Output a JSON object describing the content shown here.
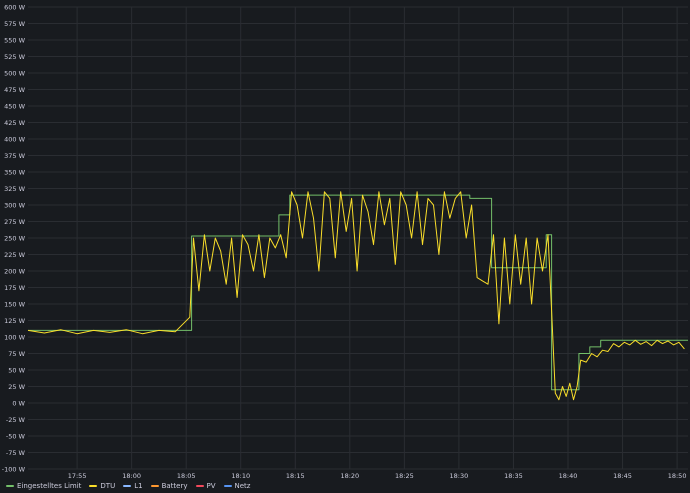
{
  "chart_data": {
    "type": "line",
    "title": "",
    "xlabel": "",
    "ylabel": "",
    "y_unit": "W",
    "ylim": [
      -100,
      600
    ],
    "y_ticks": [
      -100,
      -75,
      -50,
      -25,
      0,
      25,
      50,
      75,
      100,
      125,
      150,
      175,
      200,
      225,
      250,
      275,
      300,
      325,
      350,
      375,
      400,
      425,
      450,
      475,
      500,
      525,
      550,
      575,
      600
    ],
    "y_tick_labels": [
      "-100 W",
      "-75 W",
      "-50 W",
      "-25 W",
      "0 W",
      "25 W",
      "50 W",
      "75 W",
      "100 W",
      "125 W",
      "150 W",
      "175 W",
      "200 W",
      "225 W",
      "250 W",
      "275 W",
      "300 W",
      "325 W",
      "350 W",
      "375 W",
      "400 W",
      "425 W",
      "450 W",
      "475 W",
      "500 W",
      "525 W",
      "550 W",
      "575 W",
      "600 W"
    ],
    "xlim": [
      "17:50:30",
      "18:51:00"
    ],
    "x_ticks": [
      "17:55",
      "18:00",
      "18:05",
      "18:10",
      "18:15",
      "18:20",
      "18:25",
      "18:30",
      "18:35",
      "18:40",
      "18:45",
      "18:50"
    ],
    "grid": true,
    "legend_position": "bottom-left",
    "series": [
      {
        "name": "Eingestelltes Limit",
        "color": "#73bf69",
        "step": true,
        "x": [
          "17:50:30",
          "18:05:30",
          "18:13:30",
          "18:14:30",
          "18:31:00",
          "18:33:00",
          "18:38:00",
          "18:38:30",
          "18:41:00",
          "18:42:00",
          "18:43:00",
          "18:51:00"
        ],
        "y": [
          110,
          253,
          285,
          315,
          310,
          205,
          255,
          20,
          75,
          85,
          95,
          95
        ]
      },
      {
        "name": "DTU",
        "color": "#fade2a",
        "x": [
          "17:50:30",
          "17:52:00",
          "17:53:30",
          "17:55:00",
          "17:56:30",
          "17:58:00",
          "17:59:30",
          "18:01:00",
          "18:02:30",
          "18:04:00",
          "18:05:20",
          "18:05:40",
          "18:06:10",
          "18:06:40",
          "18:07:10",
          "18:07:40",
          "18:08:10",
          "18:08:40",
          "18:09:10",
          "18:09:40",
          "18:10:10",
          "18:10:40",
          "18:11:10",
          "18:11:40",
          "18:12:10",
          "18:12:40",
          "18:13:10",
          "18:13:40",
          "18:14:10",
          "18:14:40",
          "18:15:10",
          "18:15:40",
          "18:16:10",
          "18:16:40",
          "18:17:10",
          "18:17:40",
          "18:18:10",
          "18:18:40",
          "18:19:10",
          "18:19:40",
          "18:20:10",
          "18:20:40",
          "18:21:10",
          "18:21:40",
          "18:22:10",
          "18:22:40",
          "18:23:10",
          "18:23:40",
          "18:24:10",
          "18:24:40",
          "18:25:10",
          "18:25:40",
          "18:26:10",
          "18:26:40",
          "18:27:10",
          "18:27:40",
          "18:28:10",
          "18:28:40",
          "18:29:10",
          "18:29:40",
          "18:30:10",
          "18:30:40",
          "18:31:10",
          "18:31:40",
          "18:32:10",
          "18:32:40",
          "18:33:10",
          "18:33:40",
          "18:34:10",
          "18:34:40",
          "18:35:10",
          "18:35:40",
          "18:36:10",
          "18:36:40",
          "18:37:10",
          "18:37:40",
          "18:38:10",
          "18:38:30",
          "18:38:50",
          "18:39:10",
          "18:39:30",
          "18:39:50",
          "18:40:10",
          "18:40:30",
          "18:40:50",
          "18:41:10",
          "18:41:40",
          "18:42:10",
          "18:42:40",
          "18:43:10",
          "18:43:40",
          "18:44:10",
          "18:44:40",
          "18:45:10",
          "18:45:40",
          "18:46:10",
          "18:46:40",
          "18:47:10",
          "18:47:40",
          "18:48:10",
          "18:48:40",
          "18:49:10",
          "18:49:40",
          "18:50:10",
          "18:50:40"
        ],
        "y": [
          110,
          106,
          111,
          105,
          110,
          107,
          111,
          105,
          110,
          108,
          130,
          250,
          170,
          255,
          200,
          250,
          230,
          180,
          250,
          160,
          255,
          240,
          200,
          255,
          190,
          250,
          235,
          255,
          220,
          320,
          300,
          250,
          320,
          280,
          200,
          320,
          310,
          220,
          320,
          260,
          310,
          200,
          315,
          290,
          240,
          320,
          270,
          310,
          210,
          320,
          300,
          250,
          320,
          240,
          310,
          300,
          225,
          320,
          280,
          310,
          320,
          250,
          300,
          190,
          185,
          180,
          255,
          120,
          250,
          150,
          255,
          180,
          250,
          150,
          250,
          200,
          255,
          140,
          15,
          5,
          25,
          10,
          30,
          5,
          25,
          65,
          62,
          75,
          70,
          80,
          78,
          90,
          85,
          92,
          88,
          95,
          89,
          93,
          87,
          95,
          90,
          94,
          88,
          92,
          82
        ]
      },
      {
        "name": "L1",
        "color": "#8ab8ff",
        "x": [],
        "y": []
      },
      {
        "name": "Battery",
        "color": "#ff9830",
        "x": [],
        "y": []
      },
      {
        "name": "PV",
        "color": "#f2495c",
        "x": [],
        "y": []
      },
      {
        "name": "Netz",
        "color": "#5794f2",
        "x": [],
        "y": []
      }
    ]
  }
}
